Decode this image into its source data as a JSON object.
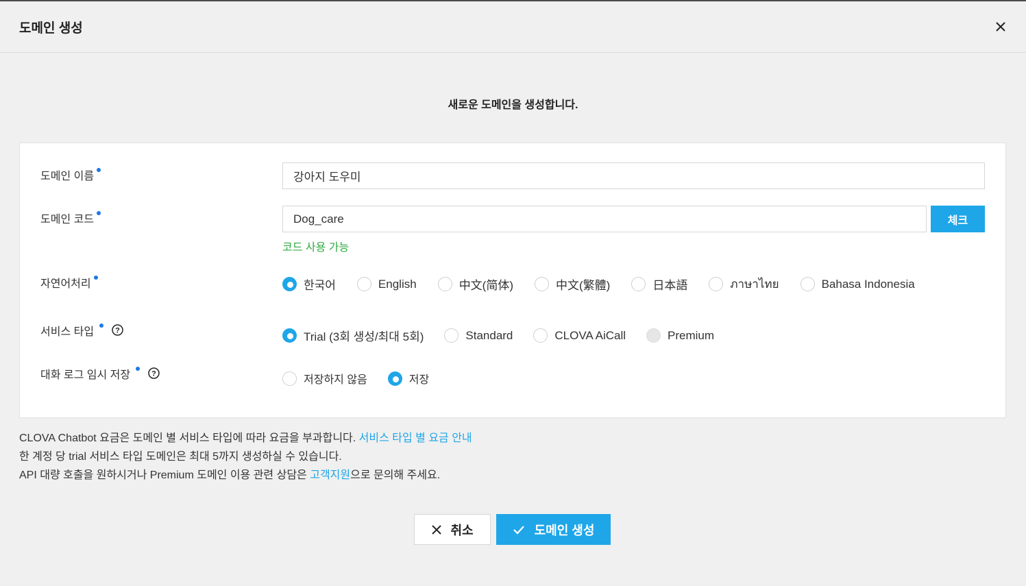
{
  "header": {
    "title": "도메인 생성",
    "close_icon": "close-icon"
  },
  "subtitle": "새로운 도메인을 생성합니다.",
  "form": {
    "domain_name": {
      "label": "도메인 이름",
      "value": "강아지 도우미"
    },
    "domain_code": {
      "label": "도메인 코드",
      "value": "Dog_care",
      "check_label": "체크",
      "status": "코드 사용 가능"
    },
    "nlp": {
      "label": "자연어처리",
      "options": [
        "한국어",
        "English",
        "中文(简体)",
        "中文(繁體)",
        "日本語",
        "ภาษาไทย",
        "Bahasa Indonesia"
      ],
      "selected": "한국어"
    },
    "service_type": {
      "label": "서비스 타입",
      "options": [
        "Trial (3회 생성/최대 5회)",
        "Standard",
        "CLOVA AiCall",
        "Premium"
      ],
      "selected": "Trial (3회 생성/최대 5회)"
    },
    "log_save": {
      "label": "대화 로그 임시 저장",
      "options": [
        "저장하지 않음",
        "저장"
      ],
      "selected": "저장"
    }
  },
  "notes": {
    "line1_text": "CLOVA Chatbot 요금은 도메인 별 서비스 타입에 따라 요금을 부과합니다. ",
    "line1_link": "서비스 타입 별 요금 안내",
    "line2_text": "한 계정 당 trial 서비스 타입 도메인은 최대 5까지 생성하실 수 있습니다.",
    "line3_text_a": "API 대량 호출을 원하시거나 Premium 도메인 이용 관련 상담은 ",
    "line3_link": "고객지원",
    "line3_text_b": "으로 문의해 주세요."
  },
  "footer": {
    "cancel_label": "취소",
    "create_label": "도메인 생성"
  },
  "colors": {
    "accent": "#1fa6e8",
    "success": "#2eaa3f",
    "required_dot": "#1f77e5"
  }
}
